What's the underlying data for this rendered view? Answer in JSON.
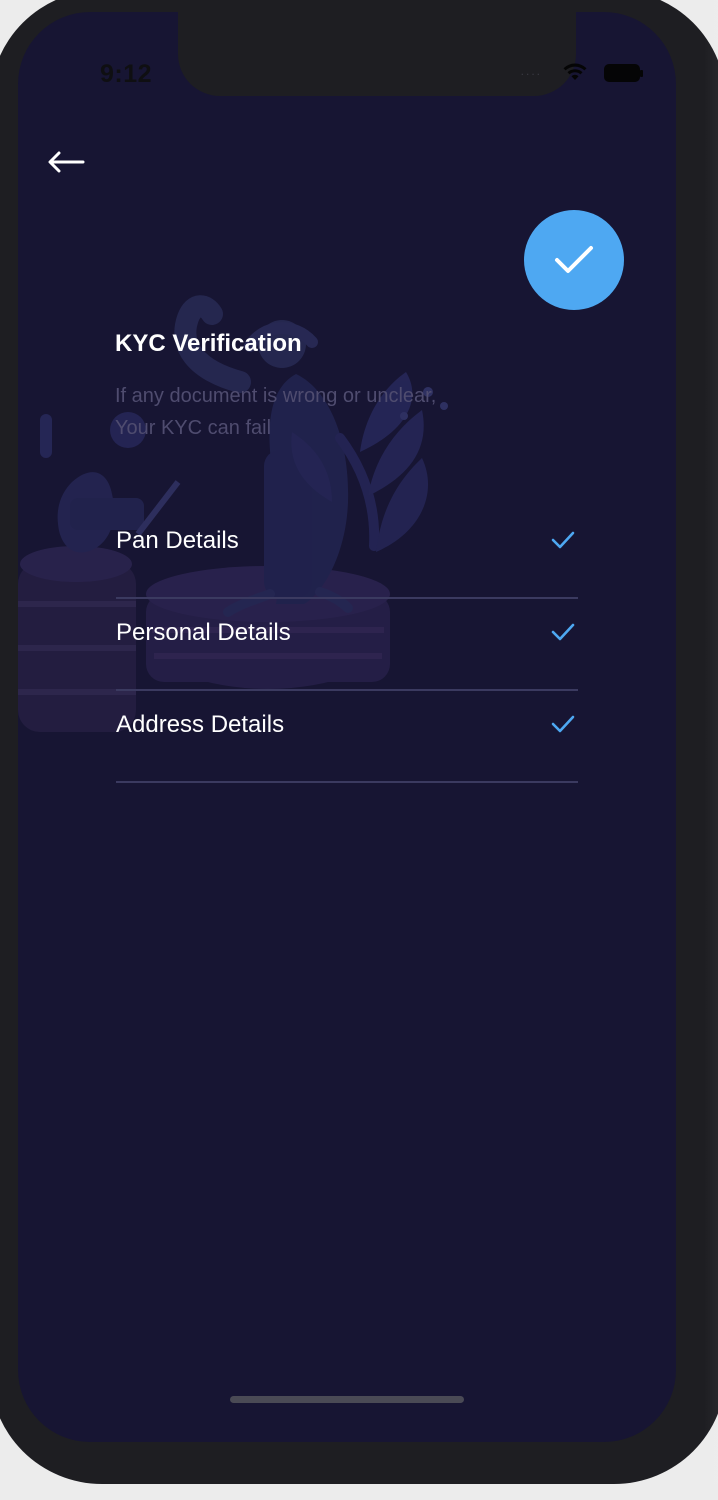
{
  "status_bar": {
    "time": "9:12",
    "signal_dots": "....",
    "wifi_icon": "wifi-icon",
    "battery_icon": "battery-icon"
  },
  "navigation": {
    "back_icon": "back-arrow-icon"
  },
  "header": {
    "title": "KYC Verification",
    "subtitle_line_1": "If any document is wrong or unclear,",
    "subtitle_line_2": "Your KYC can fail"
  },
  "success_badge": {
    "icon": "check-icon",
    "color": "#4ea8f2"
  },
  "kyc_items": [
    {
      "label": "Pan Details",
      "status_icon": "check-icon"
    },
    {
      "label": "Personal Details",
      "status_icon": "check-icon"
    },
    {
      "label": "Address Details",
      "status_icon": "check-icon"
    }
  ],
  "colors": {
    "background": "#171533",
    "text_primary": "#ffffff",
    "text_muted": "#4f4c6f",
    "accent": "#4ea8f2",
    "divider": "#3b3a60"
  },
  "illustration": {
    "name": "kyc-illustration"
  }
}
